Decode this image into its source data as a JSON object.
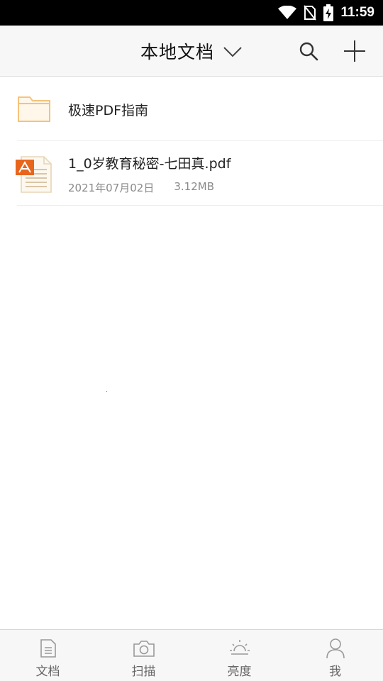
{
  "status_bar": {
    "time": "11:59"
  },
  "header": {
    "title": "本地文档"
  },
  "files": [
    {
      "type": "folder",
      "name": "极速PDF指南"
    },
    {
      "type": "pdf",
      "name": "1_0岁教育秘密-七田真.pdf",
      "date": "2021年07月02日",
      "size": "3.12MB"
    }
  ],
  "tabs": [
    {
      "label": "文档",
      "icon": "document-icon"
    },
    {
      "label": "扫描",
      "icon": "camera-icon"
    },
    {
      "label": "亮度",
      "icon": "brightness-icon"
    },
    {
      "label": "我",
      "icon": "person-icon"
    }
  ],
  "colors": {
    "folder": "#f5b24a",
    "pdf_badge": "#e8651c",
    "header_bg": "#f7f7f7"
  }
}
